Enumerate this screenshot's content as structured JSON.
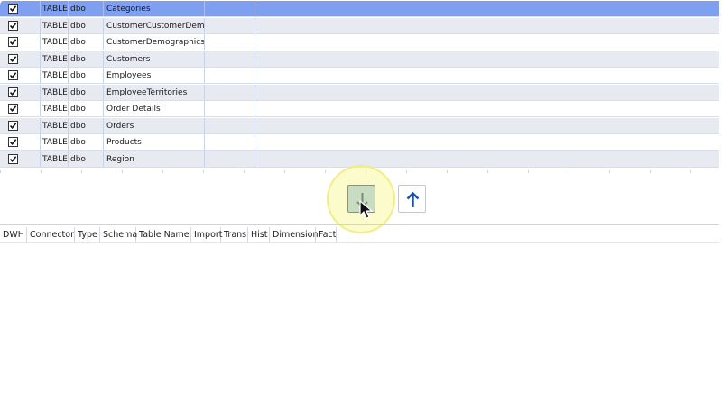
{
  "source_tables": {
    "rows": [
      {
        "checked": true,
        "type": "TABLE",
        "schema": "dbo",
        "name": "Categories",
        "selected": true
      },
      {
        "checked": true,
        "type": "TABLE",
        "schema": "dbo",
        "name": "CustomerCustomerDemo",
        "selected": false
      },
      {
        "checked": true,
        "type": "TABLE",
        "schema": "dbo",
        "name": "CustomerDemographics",
        "selected": false
      },
      {
        "checked": true,
        "type": "TABLE",
        "schema": "dbo",
        "name": "Customers",
        "selected": false
      },
      {
        "checked": true,
        "type": "TABLE",
        "schema": "dbo",
        "name": "Employees",
        "selected": false
      },
      {
        "checked": true,
        "type": "TABLE",
        "schema": "dbo",
        "name": "EmployeeTerritories",
        "selected": false
      },
      {
        "checked": true,
        "type": "TABLE",
        "schema": "dbo",
        "name": "Order Details",
        "selected": false
      },
      {
        "checked": true,
        "type": "TABLE",
        "schema": "dbo",
        "name": "Orders",
        "selected": false
      },
      {
        "checked": true,
        "type": "TABLE",
        "schema": "dbo",
        "name": "Products",
        "selected": false
      },
      {
        "checked": true,
        "type": "TABLE",
        "schema": "dbo",
        "name": "Region",
        "selected": false
      }
    ]
  },
  "move_buttons": {
    "down_icon": "arrow-down-icon",
    "up_icon": "arrow-up-icon",
    "down_color": "#7a8a78",
    "up_color": "#1f4ea3"
  },
  "dwh_grid": {
    "headers": [
      "DWH",
      "Connector",
      "Type",
      "Schema",
      "Table Name",
      "Import",
      "Trans",
      "Hist",
      "Dimension",
      "Fact"
    ],
    "rows": []
  },
  "colors": {
    "selected_row": "#7f9ff0",
    "alt_row": "#e8eaf1",
    "highlight": "#faf8a0"
  }
}
